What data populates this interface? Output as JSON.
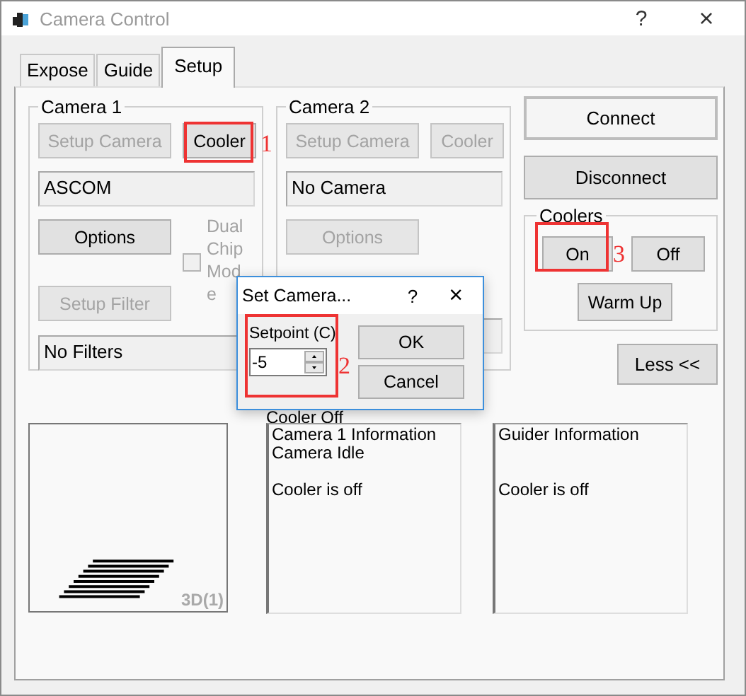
{
  "window": {
    "title": "Camera Control",
    "help": "?",
    "close": "×"
  },
  "tabs": [
    {
      "label": "Expose",
      "selected": false
    },
    {
      "label": "Guide",
      "selected": false
    },
    {
      "label": "Setup",
      "selected": true
    }
  ],
  "camera_groups": [
    {
      "title": "Camera 1",
      "setup_camera": {
        "label": "Setup Camera",
        "disabled": true
      },
      "cooler": {
        "label": "Cooler",
        "disabled": false,
        "annotation": "1"
      },
      "camera_name": "ASCOM",
      "options": {
        "label": "Options",
        "disabled": false
      },
      "dual_chip": {
        "label": "Dual Chip Mode",
        "checked": false,
        "disabled": true
      },
      "setup_filter": {
        "label": "Setup Filter",
        "disabled": true
      },
      "filter_name": "No Filters"
    },
    {
      "title": "Camera 2",
      "setup_camera": {
        "label": "Setup Camera",
        "disabled": true
      },
      "cooler": {
        "label": "Cooler",
        "disabled": true
      },
      "camera_name": "No Camera",
      "options": {
        "label": "Options",
        "disabled": true
      }
    }
  ],
  "connect": {
    "label": "Connect",
    "default": true
  },
  "disconnect": {
    "label": "Disconnect"
  },
  "coolers": {
    "title": "Coolers",
    "on": {
      "label": "On",
      "annotation": "3"
    },
    "off": {
      "label": "Off"
    },
    "warm_up": {
      "label": "Warm Up"
    }
  },
  "less": {
    "label": "Less <<"
  },
  "preview": {
    "label": "3D(1)"
  },
  "cooler_status": "Cooler Off",
  "info_panels": [
    {
      "lines": [
        "Camera 1 Information",
        "Camera Idle"
      ],
      "status": "Cooler is off"
    },
    {
      "lines": [
        "Guider Information"
      ],
      "status": "Cooler is off"
    }
  ],
  "dialog": {
    "title": "Set Camera...",
    "help": "?",
    "close": "×",
    "setpoint_label": "Setpoint (C)",
    "setpoint_value": "-5",
    "annotation": "2",
    "ok": "OK",
    "cancel": "Cancel"
  }
}
